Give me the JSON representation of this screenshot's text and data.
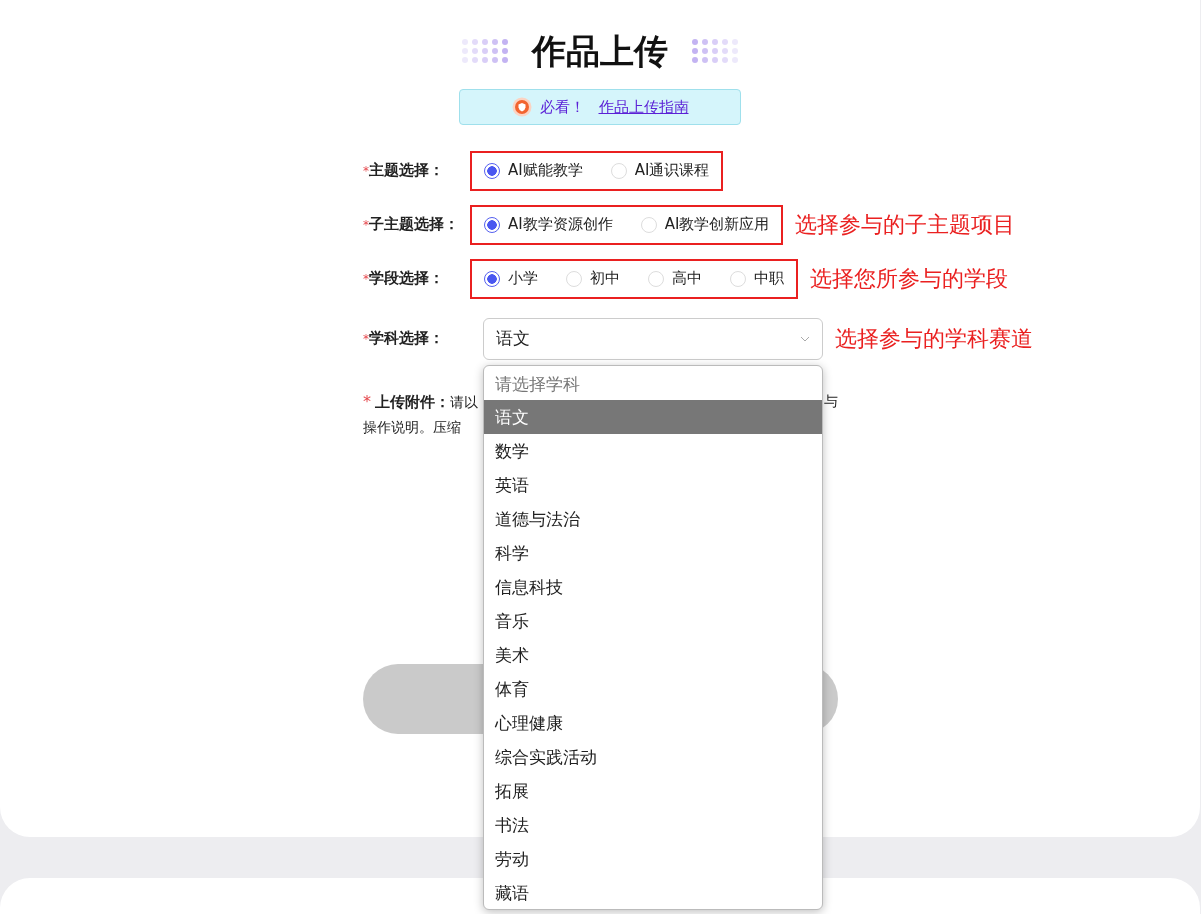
{
  "title": "作品上传",
  "notice": {
    "prefix": "必看！",
    "link": "作品上传指南"
  },
  "fields": [
    {
      "kind": "radio",
      "required_mark": "*",
      "label": "主题选择：",
      "options": [
        {
          "label": "AI赋能教学",
          "selected": true
        },
        {
          "label": "AI通识课程",
          "selected": false
        }
      ]
    },
    {
      "kind": "radio",
      "required_mark": "*",
      "label": "子主题选择：",
      "options": [
        {
          "label": "AI教学资源创作",
          "selected": true
        },
        {
          "label": "AI教学创新应用",
          "selected": false
        }
      ],
      "annotation": "选择参与的子主题项目"
    },
    {
      "kind": "radio",
      "required_mark": "*",
      "label": "学段选择：",
      "options": [
        {
          "label": "小学",
          "selected": true
        },
        {
          "label": "初中",
          "selected": false
        },
        {
          "label": "高中",
          "selected": false
        },
        {
          "label": "中职",
          "selected": false
        }
      ],
      "annotation": "选择您所参与的学段"
    },
    {
      "kind": "select",
      "required_mark": "*",
      "label": "学科选择：",
      "value": "语文",
      "annotation": "选择参与的学科赛道"
    }
  ],
  "upload": {
    "required_mark": "*",
    "label": "上传附件：",
    "line_1_start": "请以",
    "line_1_end": "与",
    "line_2": "操作说明。压缩"
  },
  "dropdown": {
    "prompt_option": "请选择学科",
    "options": [
      {
        "label": "语文",
        "selected": true
      },
      {
        "label": "数学",
        "selected": false
      },
      {
        "label": "英语",
        "selected": false
      },
      {
        "label": "道德与法治",
        "selected": false
      },
      {
        "label": "科学",
        "selected": false
      },
      {
        "label": "信息科技",
        "selected": false
      },
      {
        "label": "音乐",
        "selected": false
      },
      {
        "label": "美术",
        "selected": false
      },
      {
        "label": "体育",
        "selected": false
      },
      {
        "label": "心理健康",
        "selected": false
      },
      {
        "label": "综合实践活动",
        "selected": false
      },
      {
        "label": "拓展",
        "selected": false
      },
      {
        "label": "书法",
        "selected": false
      },
      {
        "label": "劳动",
        "selected": false
      },
      {
        "label": "藏语",
        "selected": false
      }
    ]
  }
}
